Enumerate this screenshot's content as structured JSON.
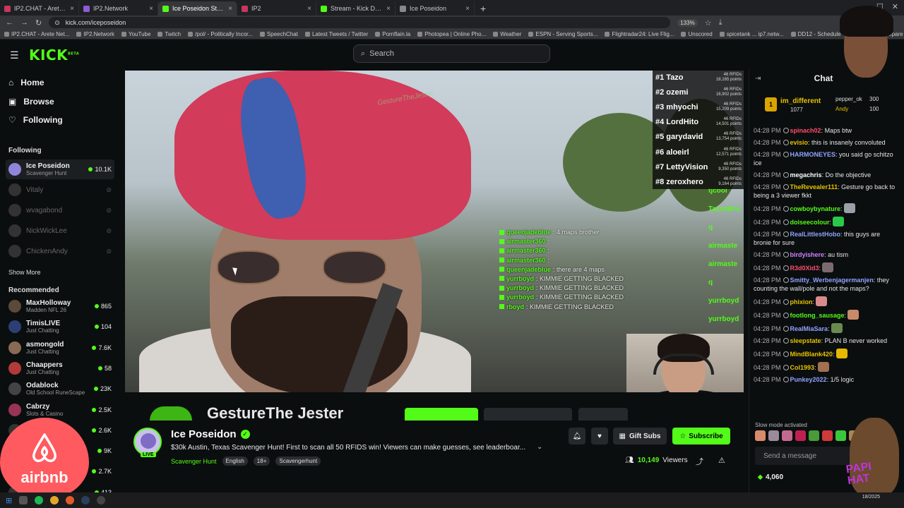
{
  "browser": {
    "tabs": [
      {
        "label": "IP2.CHAT - Arete Network",
        "color": "#c9375c",
        "active": false
      },
      {
        "label": "IP2.Network",
        "color": "#8e5bd6",
        "active": false
      },
      {
        "label": "Ice Poseidon Stream - Wa...",
        "color": "#53fc18",
        "active": true
      },
      {
        "label": "IP2",
        "color": "#c9375c",
        "active": false
      },
      {
        "label": "Stream - Kick Dashboard",
        "color": "#53fc18",
        "active": false
      },
      {
        "label": "Ice Poseidon",
        "color": "#888888",
        "active": false
      }
    ],
    "url": "kick.com/iceposeidon",
    "zoom": "133%",
    "bookmarks": [
      "IP2.CHAT - Arete Net...",
      "IP2.Network",
      "YouTube",
      "Twitch",
      "/pol/ - Politically Incor...",
      "SpeechChat",
      "Latest Tweets / Twitter",
      "Pornflain.la",
      "Photopea | Online Pho...",
      "Weather",
      "ESPN - Serving Sports...",
      "Flightradar24: Live Flig...",
      "Unscored",
      "spicetank ... ip7.netw...",
      "DD12 - Schedule",
      "Kick",
      "Compare Cheap Flight...",
      "KickBot: Customizable..."
    ]
  },
  "header": {
    "logo": "KICK",
    "logo_sup": "BETA",
    "search_placeholder": "Search"
  },
  "sidebar": {
    "nav": [
      "Home",
      "Browse",
      "Following"
    ],
    "following_title": "Following",
    "following": [
      {
        "name": "Ice Poseidon",
        "category": "Scavenger Hunt",
        "viewers": "10.1K",
        "live": true,
        "color": "#8f86d9"
      },
      {
        "name": "Vitaly",
        "live": false
      },
      {
        "name": "wvagabond",
        "live": false
      },
      {
        "name": "NickWickLee",
        "live": false
      },
      {
        "name": "ChickenAndy",
        "live": false
      }
    ],
    "show_more": "Show More",
    "recommended_title": "Recommended",
    "recommended": [
      {
        "name": "MaxHolloway",
        "category": "Madden NFL 26",
        "viewers": "865",
        "color": "#5b4a3a"
      },
      {
        "name": "TimisLIVE",
        "category": "Just Chatting",
        "viewers": "104",
        "color": "#2c3f75"
      },
      {
        "name": "asmongold",
        "category": "Just Chatting",
        "viewers": "7.6K",
        "color": "#8a6a55"
      },
      {
        "name": "Chaappers",
        "category": "Just Chatting",
        "viewers": "58",
        "color": "#b23a3a"
      },
      {
        "name": "Odablock",
        "category": "Old School RuneScape",
        "viewers": "23K",
        "color": "#444444"
      },
      {
        "name": "Cabrzy",
        "category": "Slots & Casino",
        "viewers": "2.5K",
        "color": "#9a3454"
      },
      {
        "name": "",
        "category": "",
        "viewers": "2.6K",
        "color": "#333333"
      },
      {
        "name": "",
        "category": "",
        "viewers": "9K",
        "color": "#333333"
      },
      {
        "name": "",
        "category": "",
        "viewers": "2.7K",
        "color": "#333333"
      },
      {
        "name": "",
        "category": "",
        "viewers": "413",
        "color": "#333333"
      }
    ]
  },
  "overlay": {
    "airbnb": "airbnb",
    "watermark": "GestureTheJester",
    "leaderboard": [
      {
        "rank": "#1 Tazo",
        "rfids": "46 RFIDs",
        "points": "18,165 points"
      },
      {
        "rank": "#2 ozemi",
        "rfids": "46 RFIDs",
        "points": "16,902 points"
      },
      {
        "rank": "#3 mhyochi",
        "rfids": "46 RFIDs",
        "points": "15,209 points"
      },
      {
        "rank": "#4 LordHito",
        "rfids": "46 RFIDs",
        "points": "14,501 points"
      },
      {
        "rank": "#5 garydavid",
        "rfids": "46 RFIDs",
        "points": "13,754 points"
      },
      {
        "rank": "#6 aloeirl",
        "rfids": "46 RFIDs",
        "points": "12,571 points"
      },
      {
        "rank": "#7 LettyVision",
        "rfids": "46 RFIDs",
        "points": "9,350 points"
      },
      {
        "rank": "#8 zeroxhero",
        "rfids": "46 RFIDs",
        "points": "9,164 points"
      }
    ],
    "stream_chat": [
      {
        "user": "queenjadeblue",
        "text": ": 4 maps brother"
      },
      {
        "user": "airmaster360",
        "text": ":"
      },
      {
        "user": "airmaster360",
        "text": ":"
      },
      {
        "user": "airmaster360",
        "text": ":"
      },
      {
        "user": "queenjadeblue",
        "text": ": there are 4 maps"
      },
      {
        "user": "yurrboyd",
        "text": ": KIMMIE GETTING BLACKED"
      },
      {
        "user": "yurrboyd",
        "text": ": KIMMIE GETTING BLACKED"
      },
      {
        "user": "yurrboyd",
        "text": ": KIMMIE GETTING BLACKED"
      },
      {
        "user": "rboyd",
        "text": ": KIMMIE GETTING BLACKED"
      }
    ],
    "right_names": [
      "tjcool",
      "TazosBro",
      "q",
      "airmaste",
      "airmaste",
      "q",
      "yurrboyd",
      "yurrboyd"
    ],
    "chewbacca_text": "PAPI\nHAT"
  },
  "below_video": {
    "banner": "GestureThe Jester"
  },
  "channel": {
    "name": "Ice Poseidon",
    "live_label": "LIVE",
    "title": "$30k Austin, Texas Scavenger Hunt! First to scan all 50 RFIDS win! Viewers can make guesses, see leaderboar...",
    "category": "Scavenger Hunt",
    "tags": [
      "English",
      "18+",
      "Scavengerhunt"
    ],
    "gift_label": "Gift Subs",
    "subscribe_label": "Subscribe",
    "viewers": "10,149",
    "viewers_label": "Viewers"
  },
  "chat": {
    "title": "Chat",
    "leader": {
      "rank": "1",
      "name": "im_different",
      "amount": "1077",
      "second": "pepper_ok",
      "second_val": "300",
      "third": "Andy",
      "third_val": "100"
    },
    "messages": [
      {
        "time": "04:28 PM",
        "user": "spinach02",
        "text": ": Maps btw",
        "color": "#ff4d6d"
      },
      {
        "time": "04:28 PM",
        "user": "evisio",
        "text": ": this is insanely convoluted",
        "color": "#e6c200"
      },
      {
        "time": "04:28 PM",
        "user": "HARMONEYES",
        "text": ": you said go schitzo ice",
        "color": "#8fa3ff"
      },
      {
        "time": "04:28 PM",
        "user": "megachris",
        "text": ": Do the objective",
        "color": "#ffffff"
      },
      {
        "time": "04:28 PM",
        "user": "TheRevealer111",
        "text": ": Gesture go back to being a 3 viewer fkkt",
        "color": "#e6c200"
      },
      {
        "time": "04:28 PM",
        "user": "cowboybynature",
        "text": ":",
        "color": "#53fc18",
        "emote": "#9aa0a8"
      },
      {
        "time": "04:28 PM",
        "user": "doiseecolour",
        "text": ":",
        "color": "#53fc18",
        "emote": "#2ac84a"
      },
      {
        "time": "04:28 PM",
        "user": "RealLittlestHobo",
        "text": ": this guys are bronie for sure",
        "color": "#8fa3ff"
      },
      {
        "time": "04:28 PM",
        "user": "birdyishere",
        "text": ": au tism",
        "color": "#d080ff"
      },
      {
        "time": "04:28 PM",
        "user": "R3d0Xid3",
        "text": ":",
        "color": "#ff4d6d",
        "emote": "#7a6a70"
      },
      {
        "time": "04:28 PM",
        "user": "Smitty_Werbenjagermanjen",
        "text": ": they counting the wall/pole and not the maps?",
        "color": "#8fa3ff"
      },
      {
        "time": "04:28 PM",
        "user": "phixion",
        "text": ":",
        "color": "#e6c200",
        "emote": "#d98a8a"
      },
      {
        "time": "04:28 PM",
        "user": "footlong_sausage",
        "text": ":",
        "color": "#53fc18",
        "emote": "#c98a6a"
      },
      {
        "time": "04:28 PM",
        "user": "RealMiaSara",
        "text": ":",
        "color": "#8fa3ff",
        "emote": "#6a8a50"
      },
      {
        "time": "04:28 PM",
        "user": "sleepstate",
        "text": ": PLAN B never worked",
        "color": "#e6c200"
      },
      {
        "time": "04:28 PM",
        "user": "MindBlank420",
        "text": ":",
        "color": "#e6c200",
        "emote": "#e6b800"
      },
      {
        "time": "04:28 PM",
        "user": "Col1993",
        "text": ":",
        "color": "#e6c200",
        "emote": "#a07050"
      },
      {
        "time": "04:28 PM",
        "user": "Punkey2022",
        "text": ": 1/5 logic",
        "color": "#8fa3ff"
      }
    ],
    "slow_mode": "Slow mode activated",
    "send_placeholder": "Send a message",
    "points": "4,060"
  },
  "taskbar": {
    "date": "18/2025"
  }
}
